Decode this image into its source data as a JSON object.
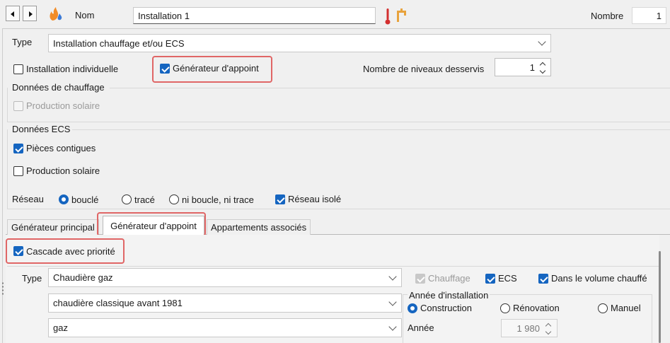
{
  "header": {
    "name_label": "Nom",
    "name_value": "Installation 1",
    "count_label": "Nombre",
    "count_value": "1"
  },
  "type": {
    "label": "Type",
    "selected": "Installation chauffage et/ou ECS"
  },
  "options": {
    "individual_label": "Installation individuelle",
    "backup_label": "Générateur d'appoint",
    "levels_label": "Nombre de niveaux desservis",
    "levels_value": "1"
  },
  "heating": {
    "title": "Données de chauffage",
    "solar_label": "Production solaire"
  },
  "ecs": {
    "title": "Données ECS",
    "contiguous_label": "Pièces contigues",
    "solar_label": "Production solaire"
  },
  "network": {
    "label": "Réseau",
    "loop_label": "bouclé",
    "traced_label": "tracé",
    "none_label": "ni boucle, ni trace",
    "isolated_label": "Réseau isolé"
  },
  "tabs": {
    "main_label": "Générateur principal",
    "backup_label": "Générateur d'appoint",
    "apartments_label": "Appartements associés"
  },
  "backup_panel": {
    "cascade_label": "Cascade avec priorité",
    "type_label": "Type",
    "type_value": "Chaudière gaz",
    "subtype_value": "chaudière classique avant 1981",
    "energy_value": "gaz",
    "heating_label": "Chauffage",
    "ecs_label": "ECS",
    "heated_volume_label": "Dans le volume chauffé",
    "install_year_group": "Année d'installation",
    "construction_label": "Construction",
    "renovation_label": "Rénovation",
    "manual_label": "Manuel",
    "year_label": "Année",
    "year_value": "1 980"
  },
  "colors": {
    "accent": "#1565c0",
    "highlight": "#e06666",
    "thermometer": "#d32f2f",
    "faucet": "#e8a33d",
    "flame": "#f28c28"
  }
}
